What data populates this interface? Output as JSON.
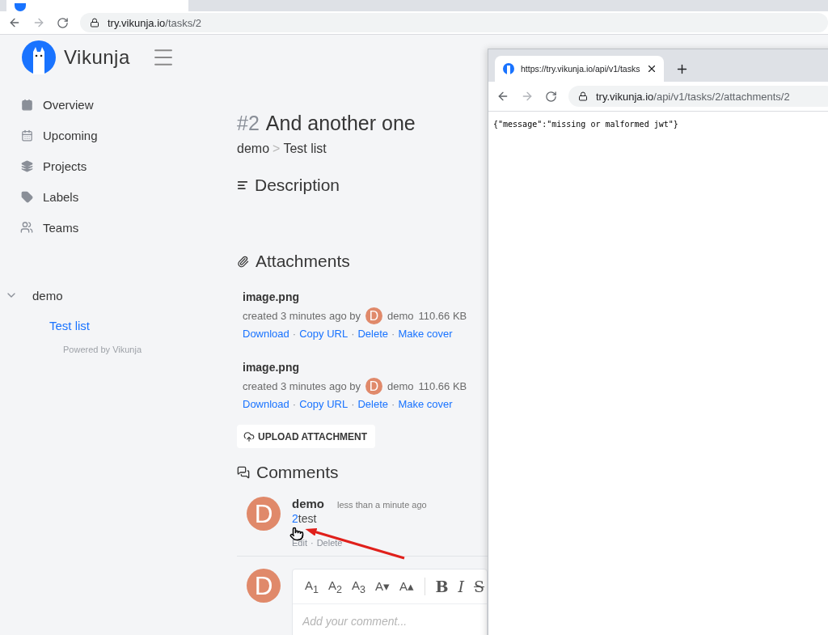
{
  "browser": {
    "url_host": "try.vikunja.io",
    "url_path": "/tasks/2"
  },
  "sidebar": {
    "brand": "Vikunja",
    "nav": [
      {
        "kind": "overview",
        "label": "Overview"
      },
      {
        "kind": "upcoming",
        "label": "Upcoming"
      },
      {
        "kind": "projects",
        "label": "Projects"
      },
      {
        "kind": "labels",
        "label": "Labels"
      },
      {
        "kind": "teams",
        "label": "Teams"
      }
    ],
    "namespaces": [
      {
        "name": "demo",
        "expanded": true,
        "children": [
          {
            "label": "Test list",
            "selected": true
          }
        ]
      }
    ],
    "footer": "Powered by Vikunja"
  },
  "task": {
    "number": "#2",
    "title": "And another one",
    "breadcrumb": [
      "demo",
      "Test list"
    ],
    "breadcrumb_separator": ">",
    "description_heading": "Description",
    "attachments_heading": "Attachments",
    "attachments": [
      {
        "name": "image.png",
        "created": "created 3 minutes ago by",
        "avatar": "D",
        "author": "demo",
        "size": "110.66 KB",
        "actions": [
          "Download",
          "Copy URL",
          "Delete",
          "Make cover"
        ]
      },
      {
        "name": "image.png",
        "created": "created 3 minutes ago by",
        "avatar": "D",
        "author": "demo",
        "size": "110.66 KB",
        "actions": [
          "Download",
          "Copy URL",
          "Delete",
          "Make cover"
        ]
      }
    ],
    "action_separator": "·",
    "upload_button": "UPLOAD ATTACHMENT",
    "comments_heading": "Comments",
    "comments": [
      {
        "avatar": "D",
        "author": "demo",
        "time": "less than a minute ago",
        "link": "2",
        "text": "test",
        "actions": [
          "Edit",
          "Delete"
        ]
      }
    ],
    "editor": {
      "avatar": "D",
      "tools": [
        {
          "kind": "heading",
          "label": "A$_{1}$"
        },
        {
          "kind": "heading",
          "label": "A$_{2}$"
        },
        {
          "kind": "heading",
          "label": "A$_{3}$"
        },
        {
          "kind": "heading",
          "label": "A▾"
        },
        {
          "kind": "heading",
          "label": "A▴"
        },
        {
          "kind": "bold",
          "label": "B"
        },
        {
          "kind": "italic",
          "label": "I"
        },
        {
          "kind": "strike",
          "label": "S"
        }
      ],
      "placeholder": "Add your comment..."
    }
  },
  "popup": {
    "tab_title": "https://try.vikunja.io/api/v1/tasks",
    "url_host": "try.vikunja.io",
    "url_path": "/api/v1/tasks/2/attachments/2",
    "body": "{\"message\":\"missing or malformed jwt\"}"
  }
}
